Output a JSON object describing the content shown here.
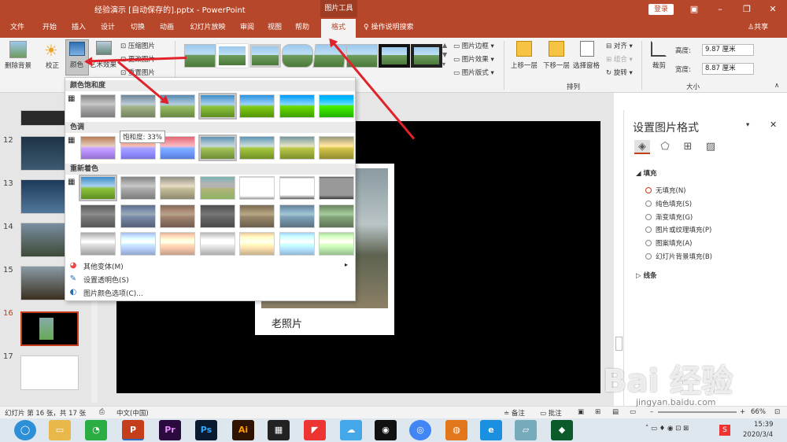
{
  "titlebar": {
    "title": "经验演示 [自动保存的].pptx - PowerPoint",
    "context_tab_label": "图片工具",
    "login": "登录"
  },
  "tabs": [
    "文件",
    "开始",
    "插入",
    "设计",
    "切换",
    "动画",
    "幻灯片放映",
    "审阅",
    "视图",
    "帮助"
  ],
  "active_tab": "格式",
  "tell_me": "操作说明搜索",
  "share": "共享",
  "ribbon": {
    "remove_bg": "删除背景",
    "correct": "校正",
    "color": "颜色",
    "artistic": "艺术效果",
    "compress": "压缩图片",
    "change": "更改图片",
    "reset": "重置图片",
    "border": "图片边框",
    "effects": "图片效果",
    "layout": "图片版式",
    "bring_forward": "上移一层",
    "send_backward": "下移一层",
    "selection_pane": "选择窗格",
    "align": "对齐",
    "group": "组合",
    "rotate": "旋转",
    "arrange_group": "排列",
    "crop": "裁剪",
    "height_label": "高度:",
    "height_value": "9.87 厘米",
    "width_label": "宽度:",
    "width_value": "8.87 厘米",
    "size_group": "大小"
  },
  "slides": {
    "numbers": [
      "12",
      "13",
      "14",
      "15",
      "16",
      "17"
    ],
    "active": "16"
  },
  "slide_content": {
    "caption": "老照片"
  },
  "dropdown": {
    "section_saturation": "颜色饱和度",
    "section_tone": "色调",
    "section_recolor": "重新着色",
    "tooltip": "饱和度: 33%",
    "more_variations": "其他变体(M)",
    "set_transparent": "设置透明色(S)",
    "color_options": "图片颜色选项(C)..."
  },
  "format_pane": {
    "title": "设置图片格式",
    "fill_section": "填充",
    "options": [
      "无填充(N)",
      "纯色填充(S)",
      "渐变填充(G)",
      "图片或纹理填充(P)",
      "图案填充(A)",
      "幻灯片背景填充(B)"
    ],
    "line_section": "线条"
  },
  "statusbar": {
    "slide_info": "幻灯片 第 16 张，共 17 张",
    "language": "中文(中国)",
    "notes": "备注",
    "comments": "批注",
    "zoom": "66%"
  },
  "taskbar": {
    "time": "15:39",
    "date": "2020/3/4"
  },
  "watermark": {
    "site": "jingyan.baidu.com",
    "brand": "Bai 经验"
  }
}
